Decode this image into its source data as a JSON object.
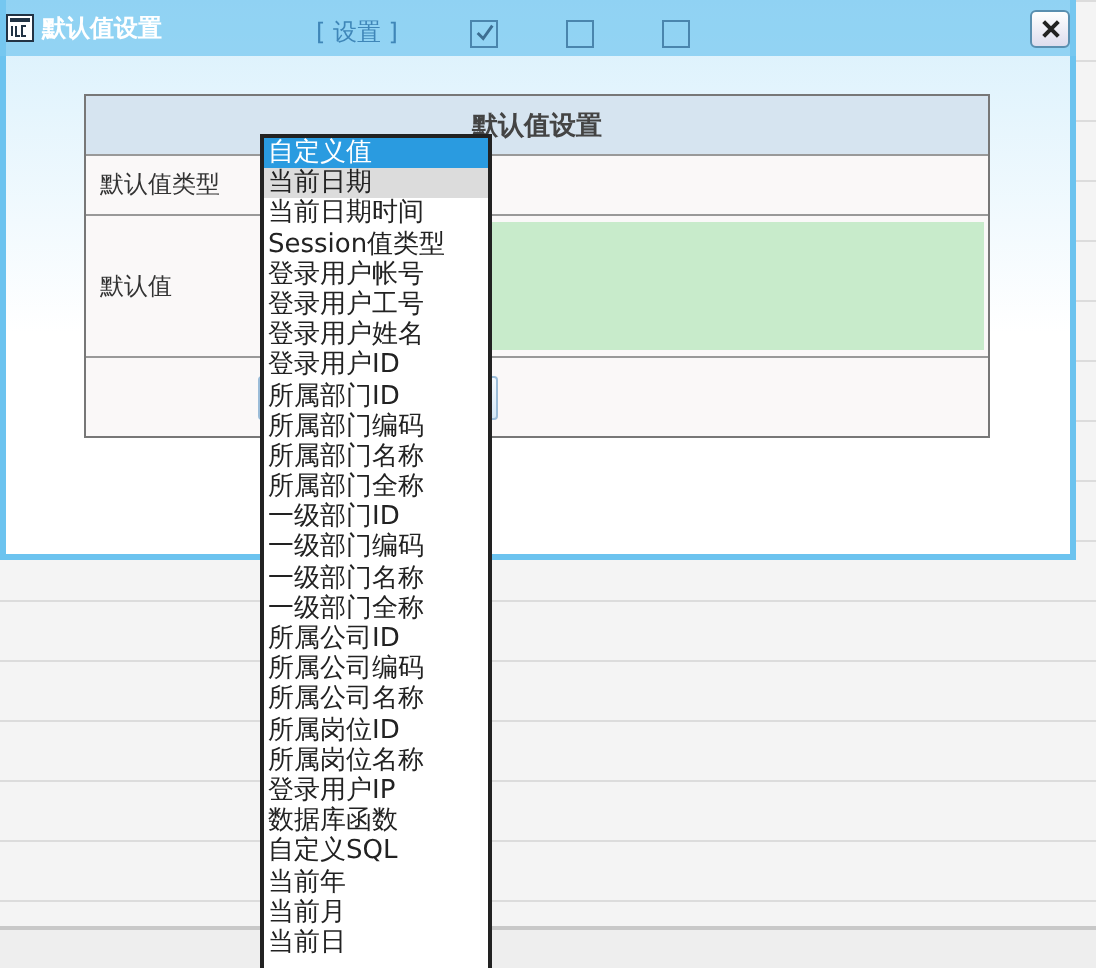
{
  "background_grid": {
    "header_text": "[ 设置 ]",
    "checkboxes": [
      {
        "checked": true
      },
      {
        "checked": false
      },
      {
        "checked": false
      }
    ]
  },
  "dialog": {
    "title": "默认值设置"
  },
  "form": {
    "heading": "默认值设置",
    "rows": [
      {
        "label": "默认值类型",
        "kind": "select"
      },
      {
        "label": "默认值",
        "kind": "value"
      }
    ]
  },
  "dropdown": {
    "items": [
      {
        "label": "自定义值",
        "selected": true,
        "highlighted": false
      },
      {
        "label": "当前日期",
        "selected": false,
        "highlighted": true
      },
      {
        "label": "当前日期时间",
        "selected": false,
        "highlighted": false
      },
      {
        "label": "Session值类型",
        "selected": false,
        "highlighted": false
      },
      {
        "label": "登录用户帐号",
        "selected": false,
        "highlighted": false
      },
      {
        "label": "登录用户工号",
        "selected": false,
        "highlighted": false
      },
      {
        "label": "登录用户姓名",
        "selected": false,
        "highlighted": false
      },
      {
        "label": "登录用户ID",
        "selected": false,
        "highlighted": false
      },
      {
        "label": "所属部门ID",
        "selected": false,
        "highlighted": false
      },
      {
        "label": "所属部门编码",
        "selected": false,
        "highlighted": false
      },
      {
        "label": "所属部门名称",
        "selected": false,
        "highlighted": false
      },
      {
        "label": "所属部门全称",
        "selected": false,
        "highlighted": false
      },
      {
        "label": "一级部门ID",
        "selected": false,
        "highlighted": false
      },
      {
        "label": "一级部门编码",
        "selected": false,
        "highlighted": false
      },
      {
        "label": "一级部门名称",
        "selected": false,
        "highlighted": false
      },
      {
        "label": "一级部门全称",
        "selected": false,
        "highlighted": false
      },
      {
        "label": "所属公司ID",
        "selected": false,
        "highlighted": false
      },
      {
        "label": "所属公司编码",
        "selected": false,
        "highlighted": false
      },
      {
        "label": "所属公司名称",
        "selected": false,
        "highlighted": false
      },
      {
        "label": "所属岗位ID",
        "selected": false,
        "highlighted": false
      },
      {
        "label": "所属岗位名称",
        "selected": false,
        "highlighted": false
      },
      {
        "label": "登录用户IP",
        "selected": false,
        "highlighted": false
      },
      {
        "label": "数据库函数",
        "selected": false,
        "highlighted": false
      },
      {
        "label": "自定义SQL",
        "selected": false,
        "highlighted": false
      },
      {
        "label": "当前年",
        "selected": false,
        "highlighted": false
      },
      {
        "label": "当前月",
        "selected": false,
        "highlighted": false
      },
      {
        "label": "当前日",
        "selected": false,
        "highlighted": false
      }
    ]
  }
}
